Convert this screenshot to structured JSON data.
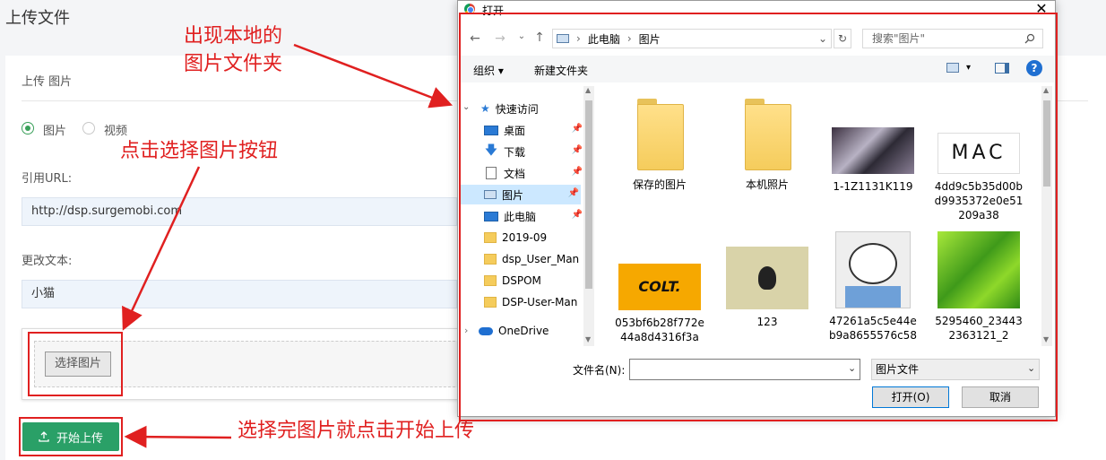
{
  "page": {
    "title": "上传文件"
  },
  "form": {
    "section_title": "上传 图片",
    "radio_image": "图片",
    "radio_video": "视频",
    "url_label": "引用URL:",
    "url_value": "http://dsp.surgemobi.com",
    "text_label": "更改文本:",
    "text_value": "小猫",
    "choose_button": "选择图片",
    "start_button": "开始上传",
    "accent_color": "#2aa067"
  },
  "annotations": {
    "folder_note_line1": "出现本地的",
    "folder_note_line2": "图片文件夹",
    "choose_note": "点击选择图片按钮",
    "upload_note": "选择完图片就点击开始上传",
    "color": "#e02020"
  },
  "dialog": {
    "title": "打开",
    "breadcrumb": [
      "此电脑",
      "图片"
    ],
    "search_placeholder": "搜索\"图片\"",
    "organize": "组织",
    "new_folder": "新建文件夹",
    "nav": [
      {
        "label": "快速访问",
        "icon": "star-icon"
      },
      {
        "label": "桌面",
        "icon": "desktop-icon",
        "pinned": true
      },
      {
        "label": "下载",
        "icon": "download-icon",
        "pinned": true
      },
      {
        "label": "文档",
        "icon": "document-icon",
        "pinned": true
      },
      {
        "label": "图片",
        "icon": "pictures-icon",
        "pinned": true,
        "selected": true
      },
      {
        "label": "此电脑",
        "icon": "computer-icon",
        "pinned": true
      },
      {
        "label": "2019-09",
        "icon": "folder-icon"
      },
      {
        "label": "dsp_User_Man",
        "icon": "folder-icon"
      },
      {
        "label": "DSPOM",
        "icon": "folder-icon"
      },
      {
        "label": "DSP-User-Man",
        "icon": "folder-icon"
      },
      {
        "label": "OneDrive",
        "icon": "cloud-icon"
      }
    ],
    "files": [
      {
        "name": "保存的图片",
        "kind": "folder"
      },
      {
        "name": "本机照片",
        "kind": "folder"
      },
      {
        "name": "1-1Z1131K119",
        "kind": "anime-image"
      },
      {
        "name": "4dd9c5b35d00bd9935372e0e51209a38",
        "kind": "mac-logo-image",
        "logo_text": "MAC"
      },
      {
        "name": "053bf6b28f772e44a8d4316f3a",
        "kind": "colt-image",
        "logo_text": "COLT."
      },
      {
        "name": "123",
        "kind": "cat-image"
      },
      {
        "name": "47261a5c5e44eb9a8655576c58",
        "kind": "meme-image"
      },
      {
        "name": "5295460_234432363121_2",
        "kind": "green-poly-image"
      }
    ],
    "filename_label": "文件名(N):",
    "filetype": "图片文件",
    "open_button": "打开(O)",
    "cancel_button": "取消"
  }
}
